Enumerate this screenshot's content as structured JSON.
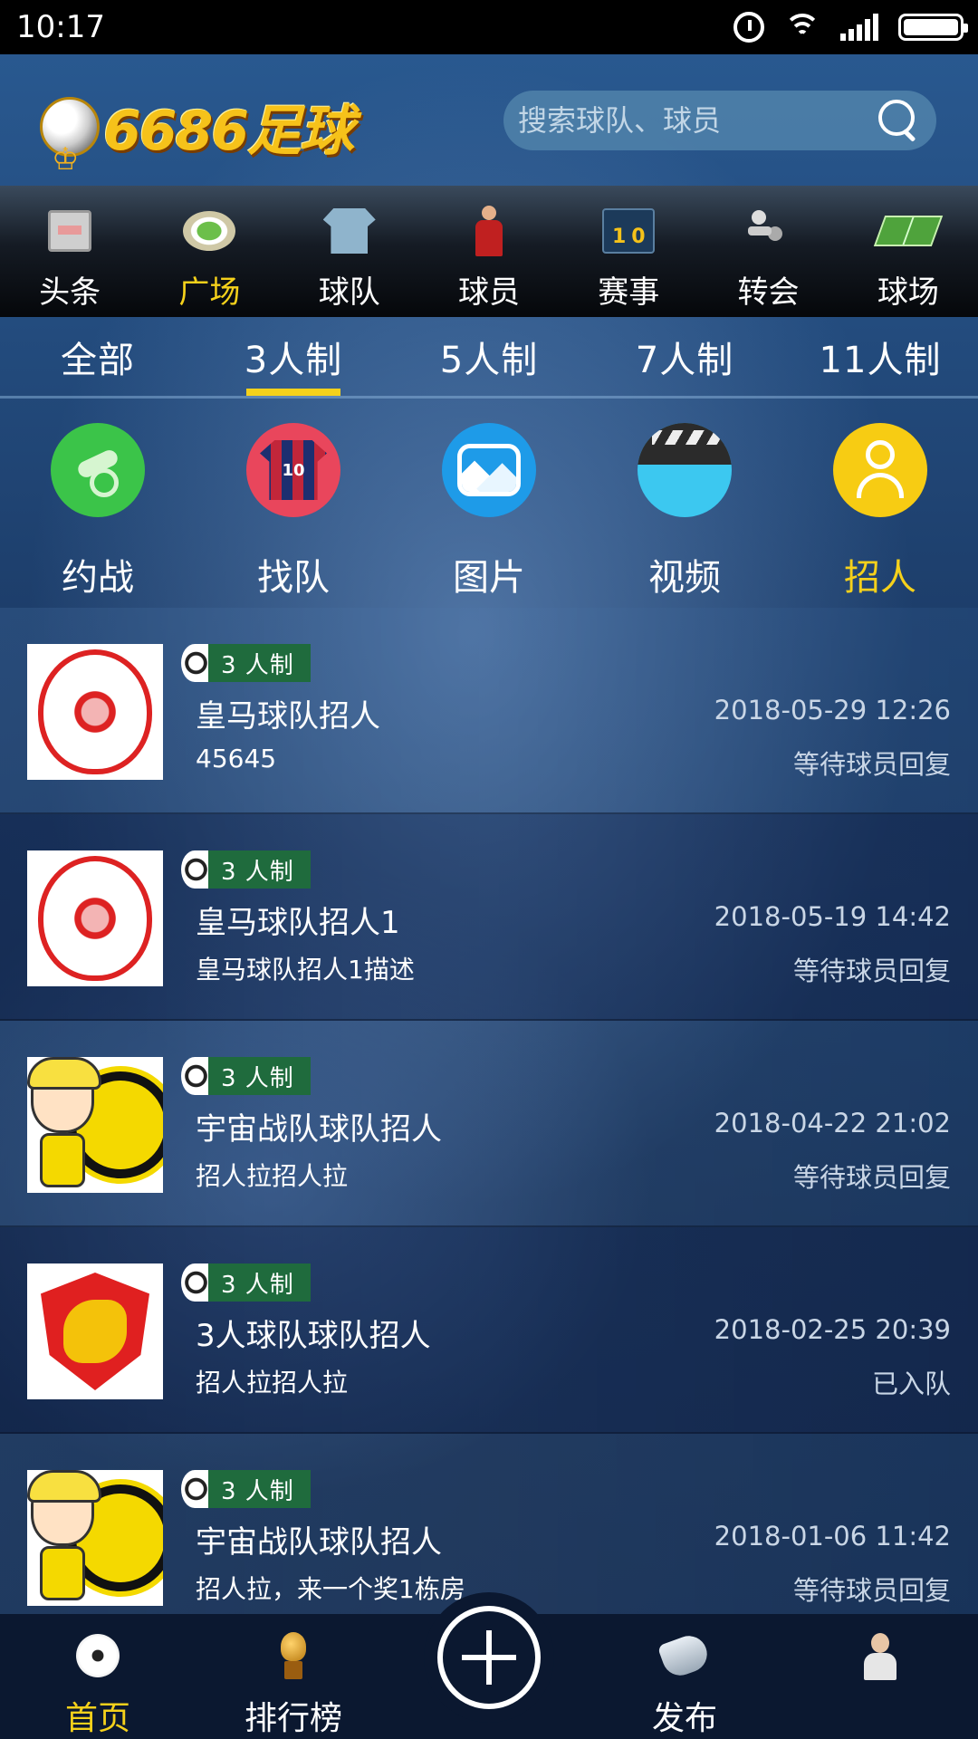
{
  "status_bar": {
    "time": "10:17"
  },
  "header": {
    "logo_text": "6686足球",
    "search_placeholder": "搜索球队、球员"
  },
  "categories": [
    {
      "label": "头条",
      "icon": "news-icon",
      "active": false
    },
    {
      "label": "广场",
      "icon": "stadium-icon",
      "active": true
    },
    {
      "label": "球队",
      "icon": "jersey-icon",
      "active": false
    },
    {
      "label": "球员",
      "icon": "player-icon",
      "active": false
    },
    {
      "label": "赛事",
      "icon": "scoreboard-icon",
      "active": false
    },
    {
      "label": "转会",
      "icon": "transfer-icon",
      "active": false
    },
    {
      "label": "球场",
      "icon": "pitch-icon",
      "active": false
    }
  ],
  "format_tabs": [
    {
      "label": "全部",
      "active": false
    },
    {
      "label": "3人制",
      "active": true
    },
    {
      "label": "5人制",
      "active": false
    },
    {
      "label": "7人制",
      "active": false
    },
    {
      "label": "11人制",
      "active": false
    }
  ],
  "actions": [
    {
      "label": "约战",
      "icon": "cannon-icon",
      "color": "#3bc449",
      "active": false
    },
    {
      "label": "找队",
      "icon": "shirt-icon",
      "color": "#e9465c",
      "shirt_number": "10",
      "active": false
    },
    {
      "label": "图片",
      "icon": "photo-icon",
      "color": "#1e9be8",
      "active": false
    },
    {
      "label": "视频",
      "icon": "clapperboard-icon",
      "color": "#3cc8f0",
      "active": false
    },
    {
      "label": "招人",
      "icon": "user-icon",
      "color": "#f7cc13",
      "active": true
    }
  ],
  "posts": [
    {
      "tag": "3 人制",
      "title": "皇马球队招人",
      "desc": "45645",
      "date": "2018-05-29 12:26",
      "status": "等待球员回复",
      "crest": "red"
    },
    {
      "tag": "3 人制",
      "title": "皇马球队招人1",
      "desc": "皇马球队招人1描述",
      "date": "2018-05-19 14:42",
      "status": "等待球员回复",
      "crest": "red"
    },
    {
      "tag": "3 人制",
      "title": "宇宙战队球队招人",
      "desc": "招人拉招人拉",
      "date": "2018-04-22 21:02",
      "status": "等待球员回复",
      "crest": "bvb"
    },
    {
      "tag": "3 人制",
      "title": "3人球队球队招人",
      "desc": "招人拉招人拉",
      "date": "2018-02-25 20:39",
      "status": "已入队",
      "crest": "gz"
    },
    {
      "tag": "3 人制",
      "title": "宇宙战队球队招人",
      "desc": "招人拉，来一个奖1栋房",
      "date": "2018-01-06 11:42",
      "status": "等待球员回复",
      "crest": "bvb"
    }
  ],
  "bottom_nav": [
    {
      "label": "首页",
      "icon": "ball-icon",
      "active": true
    },
    {
      "label": "排行榜",
      "icon": "trophy-icon",
      "active": false
    },
    {
      "label": "发布",
      "icon": "whistle-icon",
      "active": false
    },
    {
      "label": "",
      "icon": "profile-icon",
      "active": false
    }
  ],
  "colors": {
    "accent": "#f5d11b",
    "tag_bg": "#1f6b3d"
  }
}
